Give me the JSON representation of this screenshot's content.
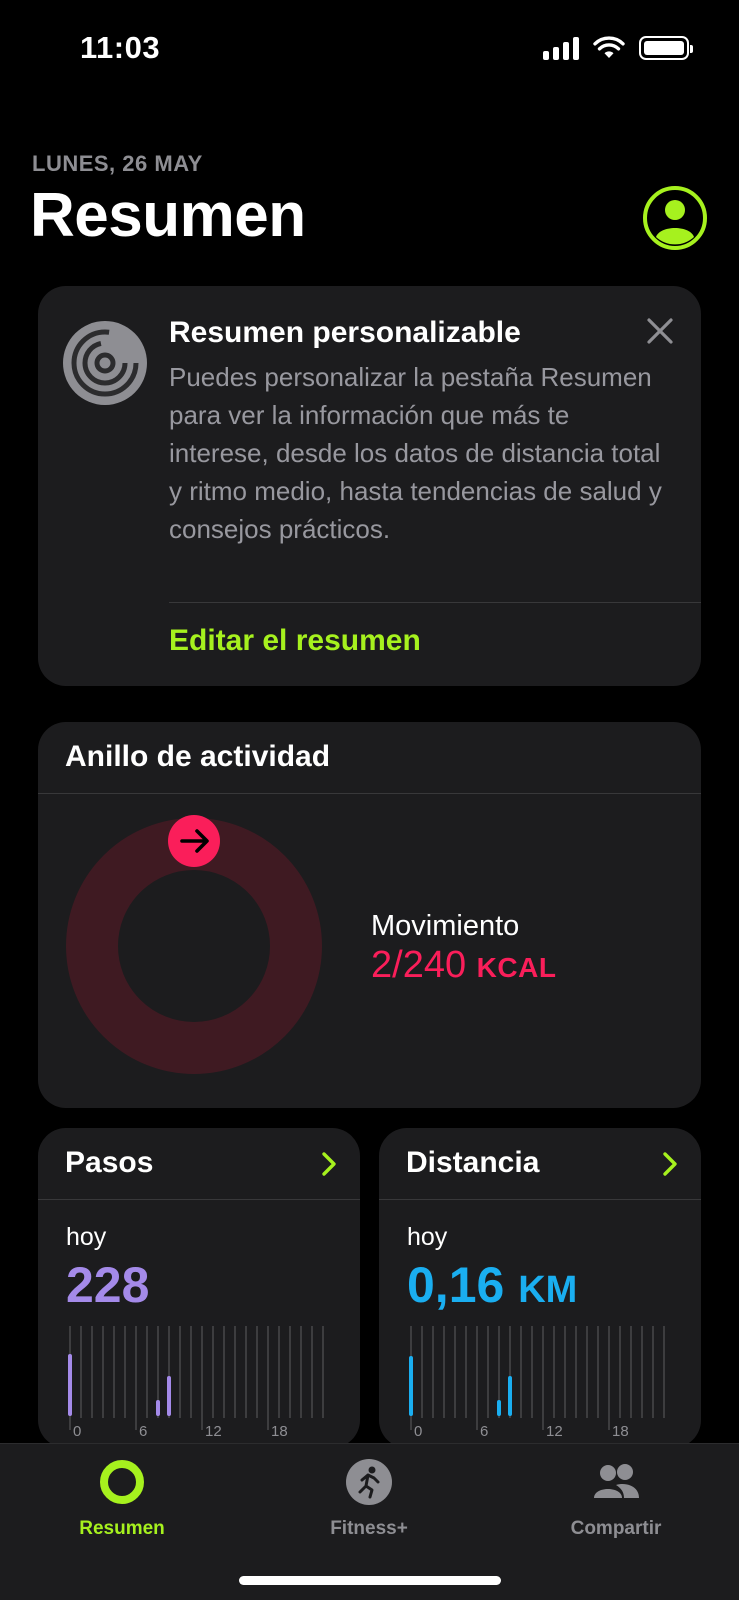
{
  "status_bar": {
    "time": "11:03"
  },
  "header": {
    "date": "LUNES, 26 MAY",
    "title": "Resumen"
  },
  "summary_card": {
    "title": "Resumen personalizable",
    "body": "Puedes personalizar la pestaña Resumen para ver la información que más te interese, desde los datos de distancia total y ritmo medio, hasta tendencias de salud y consejos prácticos.",
    "link": "Editar el resumen"
  },
  "activity_card": {
    "title": "Anillo de actividad",
    "move_label": "Movimiento",
    "move_current": 2,
    "move_goal": 240,
    "move_value": "2/240",
    "move_unit": "KCAL",
    "ring_color": "#fa1e5a"
  },
  "steps_card": {
    "title": "Pasos",
    "period": "hoy",
    "value": "228",
    "color": "#a48ae9",
    "axis_ticks": [
      "0",
      "6",
      "12",
      "18"
    ]
  },
  "distance_card": {
    "title": "Distancia",
    "period": "hoy",
    "value": "0,16",
    "unit": "KM",
    "color": "#1aaef0",
    "axis_ticks": [
      "0",
      "6",
      "12",
      "18"
    ]
  },
  "tab_bar": {
    "tabs": [
      {
        "label": "Resumen",
        "icon": "activity-ring-icon",
        "active": true
      },
      {
        "label": "Fitness+",
        "icon": "running-figure-icon",
        "active": false
      },
      {
        "label": "Compartir",
        "icon": "people-icon",
        "active": false
      }
    ]
  },
  "colors": {
    "accent": "#a6f11e",
    "move": "#fa1e5a"
  }
}
